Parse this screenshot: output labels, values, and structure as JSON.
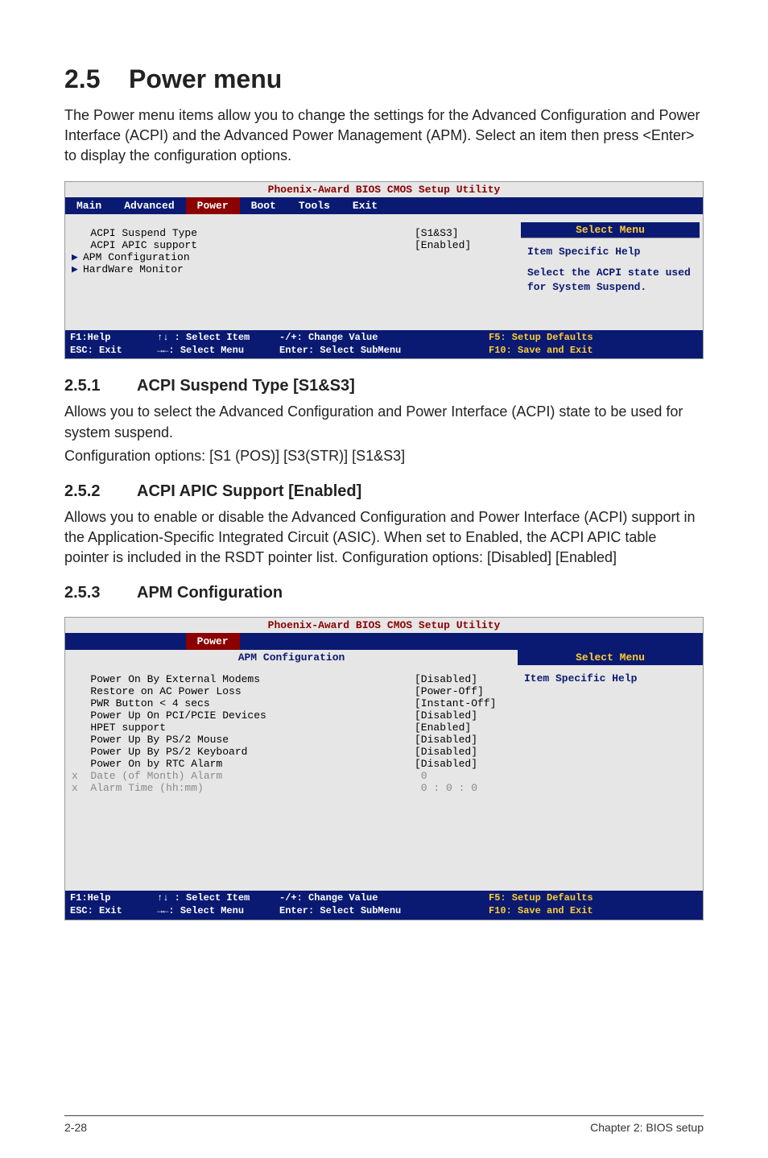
{
  "heading": {
    "num": "2.5",
    "title": "Power menu"
  },
  "intro": "The Power menu items allow you to change the settings for the Advanced Configuration and Power Interface (ACPI) and the Advanced Power Management (APM). Select an item then press <Enter> to display the configuration options.",
  "bios1": {
    "title": "Phoenix-Award BIOS CMOS Setup Utility",
    "menu": {
      "main": "Main",
      "advanced": "Advanced",
      "power": "Power",
      "boot": "Boot",
      "tools": "Tools",
      "exit": "Exit"
    },
    "rows": {
      "r1": {
        "label": "   ACPI Suspend Type",
        "value": "[S1&S3]"
      },
      "r2": {
        "label": "   ACPI APIC support",
        "value": "[Enabled]"
      },
      "r3": {
        "label": "APM Configuration",
        "value": ""
      },
      "r4": {
        "label": "HardWare Monitor",
        "value": ""
      }
    },
    "select_menu": "Select Menu",
    "help_title": "Item Specific Help",
    "help_body": "Select the ACPI state used for System  Suspend.",
    "footer": {
      "c1": "F1:Help        ↑↓ : Select Item\nESC: Exit      →←: Select Menu",
      "c2": "-/+: Change Value\nEnter: Select SubMenu",
      "c3": "F5: Setup Defaults\nF10: Save and Exit"
    }
  },
  "sec251": {
    "num": "2.5.1",
    "title": "ACPI Suspend Type [S1&S3]",
    "p1": "Allows you to select the Advanced Configuration and Power Interface (ACPI) state to be used for system suspend.",
    "p2": "Configuration options: [S1 (POS)] [S3(STR)] [S1&S3]"
  },
  "sec252": {
    "num": "2.5.2",
    "title": "ACPI APIC Support [Enabled]",
    "p1": "Allows you to enable or disable the Advanced Configuration and Power Interface (ACPI) support in the Application-Specific Integrated Circuit (ASIC). When set to Enabled, the ACPI APIC table pointer is included in the RSDT pointer list. Configuration options: [Disabled] [Enabled]"
  },
  "sec253": {
    "num": "2.5.3",
    "title": "APM Configuration"
  },
  "bios2": {
    "title": "Phoenix-Award BIOS CMOS Setup Utility",
    "power_tab": "Power",
    "panel_title": "APM Configuration",
    "select_menu": "Select Menu",
    "help_title": "Item Specific Help",
    "rows": {
      "r1": {
        "label": "   Power On By External Modems",
        "value": "[Disabled]"
      },
      "r2": {
        "label": "   Restore on AC Power Loss",
        "value": "[Power-Off]"
      },
      "r3": {
        "label": "   PWR Button < 4 secs",
        "value": "[Instant-Off]"
      },
      "r4": {
        "label": "   Power Up On PCI/PCIE Devices",
        "value": "[Disabled]"
      },
      "r5": {
        "label": "   HPET support",
        "value": "[Enabled]"
      },
      "r6": {
        "label": "   Power Up By PS/2 Mouse",
        "value": "[Disabled]"
      },
      "r7": {
        "label": "   Power Up By PS/2 Keyboard",
        "value": "[Disabled]"
      },
      "r8": {
        "label": "   Power On by RTC Alarm",
        "value": "[Disabled]"
      },
      "r9": {
        "label": "x  Date (of Month) Alarm",
        "value": " 0"
      },
      "r10": {
        "label": "x  Alarm Time (hh:mm)",
        "value": " 0 : 0 : 0"
      }
    },
    "footer": {
      "c1": "F1:Help        ↑↓ : Select Item\nESC: Exit      →←: Select Menu",
      "c2": "-/+: Change Value\nEnter: Select SubMenu",
      "c3": "F5: Setup Defaults\nF10: Save and Exit"
    }
  },
  "footer": {
    "left": "2-28",
    "right": "Chapter 2: BIOS setup"
  }
}
